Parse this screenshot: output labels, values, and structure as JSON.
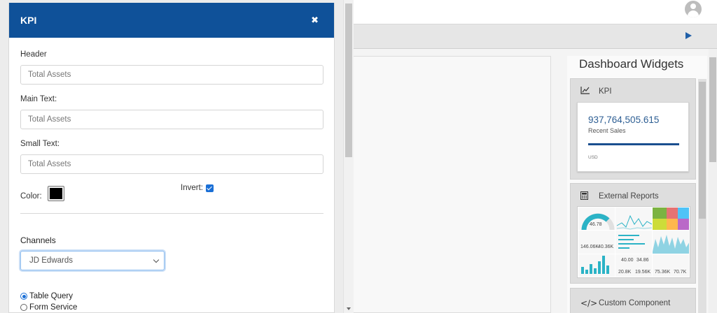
{
  "dialog": {
    "title": "KPI",
    "fields": [
      {
        "label": "Header",
        "value": "Total Assets"
      },
      {
        "label": "Main Text:",
        "value": "Total Assets"
      },
      {
        "label": "Small Text:",
        "value": "Total Assets"
      }
    ],
    "color_label": "Color:",
    "color_value": "#000000",
    "invert_label": "Invert:",
    "invert_checked": true,
    "channels_label": "Channels",
    "channel_selected": "JD Edwards",
    "radio_options": [
      {
        "label": "Table Query",
        "checked": true
      },
      {
        "label": "Form Service",
        "checked": false
      }
    ]
  },
  "widgets": {
    "title": "Dashboard Widgets",
    "items": [
      {
        "label": "KPI",
        "icon": "line-chart-icon"
      },
      {
        "label": "External Reports",
        "icon": "calculator-icon"
      },
      {
        "label": "Custom Component",
        "icon": "code-icon"
      }
    ],
    "kpi_preview": {
      "value": "937,764,505.615",
      "label": "Recent Sales",
      "unit": "USD"
    },
    "report_numbers": [
      "46.78",
      "146.06K",
      "40.36K",
      "40.00",
      "34.86",
      "20.8K",
      "19.56K",
      "75.36K",
      "70.7K"
    ]
  },
  "colors": {
    "header_blue": "#0f5199",
    "kpi_blue": "#2d5e93",
    "accent": "#1a6fd6"
  }
}
